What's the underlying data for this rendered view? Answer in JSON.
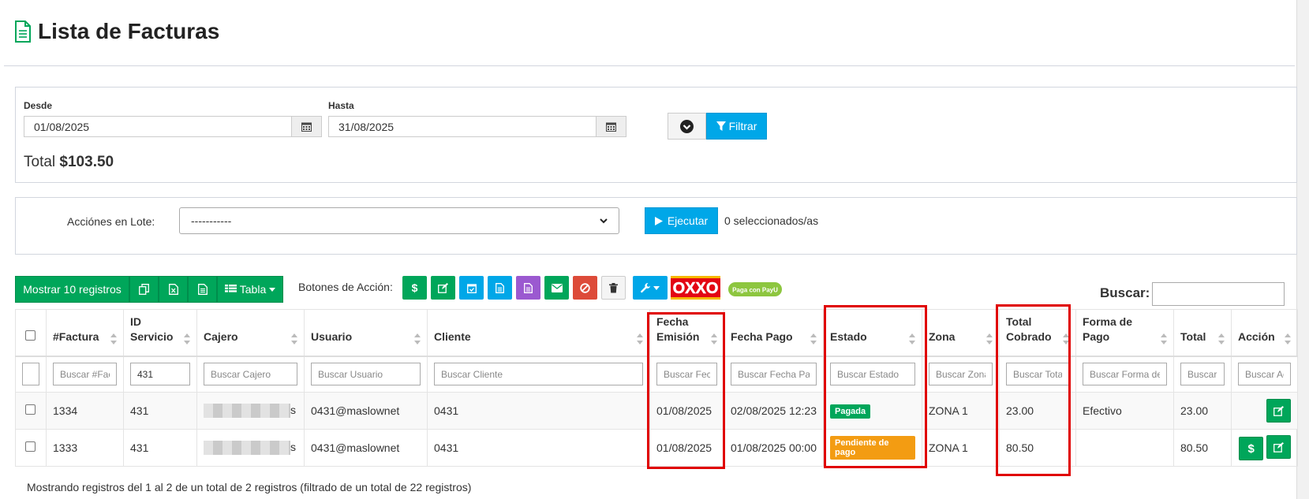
{
  "page": {
    "title": "Lista de Facturas"
  },
  "filters": {
    "desde_label": "Desde",
    "desde_value": "01/08/2025",
    "hasta_label": "Hasta",
    "hasta_value": "31/08/2025",
    "filter_button": "Filtrar",
    "total_label": "Total",
    "total_value": "$103.50"
  },
  "lot": {
    "label": "Acciónes en Lote:",
    "selected": "-----------",
    "execute_button": "Ejecutar",
    "selected_count": "0 seleccionados/as"
  },
  "toolbar": {
    "show_records": "Mostrar 10 registros",
    "table_view": "Tabla",
    "action_buttons_label": "Botones de Acción:",
    "oxxo_text": "OXXO",
    "payu_text": "Paga con PayU",
    "search_label": "Buscar:"
  },
  "colors": {
    "green": "#00a65a",
    "blue": "#00a7e8",
    "purple": "#9b59d0",
    "red": "#dd4b39",
    "orange": "#f39c12",
    "highlight": "#e00000"
  },
  "table": {
    "headers": [
      "#Factura",
      "ID Servicio",
      "Cajero",
      "Usuario",
      "Cliente",
      "Fecha Emisión",
      "Fecha Pago",
      "Estado",
      "Zona",
      "Total Cobrado",
      "Forma de Pago",
      "Total",
      "Acción"
    ],
    "filter_placeholders": [
      "Buscar #Factura",
      "",
      "Buscar Cajero",
      "Buscar Usuario",
      "Buscar Cliente",
      "Buscar Fecha Emisión",
      "Buscar Fecha Pago",
      "Buscar Estado",
      "Buscar Zona",
      "Buscar Total Cobrado",
      "Buscar Forma de Pago",
      "Buscar Total",
      "Buscar Acción"
    ],
    "id_filter_value": "431",
    "rows": [
      {
        "factura": "1334",
        "id_servicio": "431",
        "cajero_tail": "s",
        "usuario": "0431@maslownet",
        "cliente": "0431",
        "fecha_emision": "01/08/2025",
        "fecha_pago": "02/08/2025 12:23",
        "estado": "Pagada",
        "estado_color": "#00a65a",
        "zona": "ZONA 1",
        "total_cobrado": "23.00",
        "forma_pago": "Efectivo",
        "total": "23.00"
      },
      {
        "factura": "1333",
        "id_servicio": "431",
        "cajero_tail": "s",
        "usuario": "0431@maslownet",
        "cliente": "0431",
        "fecha_emision": "01/08/2025",
        "fecha_pago": "01/08/2025 00:00",
        "estado": "Pendiente de pago",
        "estado_color": "#f39c12",
        "zona": "ZONA 1",
        "total_cobrado": "80.50",
        "forma_pago": "",
        "total": "80.50"
      }
    ]
  },
  "footer": {
    "info": "Mostrando registros del 1 al 2 de un total de 2 registros (filtrado de un total de 22 registros)"
  }
}
